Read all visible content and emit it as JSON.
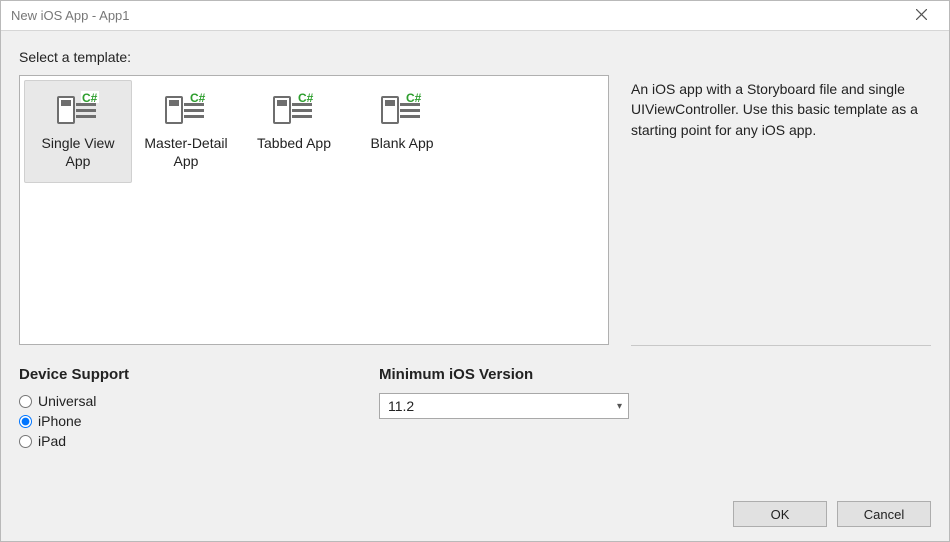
{
  "window": {
    "title": "New iOS App - App1"
  },
  "prompt": "Select a template:",
  "templates": [
    {
      "name": "Single View App",
      "selected": true
    },
    {
      "name": "Master-Detail App",
      "selected": false
    },
    {
      "name": "Tabbed App",
      "selected": false
    },
    {
      "name": "Blank App",
      "selected": false
    }
  ],
  "description": "An iOS app with a Storyboard file and single UIViewController. Use this basic template as a starting point for any iOS app.",
  "device_support": {
    "heading": "Device Support",
    "options": [
      {
        "label": "Universal",
        "checked": false
      },
      {
        "label": "iPhone",
        "checked": true
      },
      {
        "label": "iPad",
        "checked": false
      }
    ]
  },
  "min_ios": {
    "heading": "Minimum iOS Version",
    "selected": "11.2"
  },
  "buttons": {
    "ok": "OK",
    "cancel": "Cancel"
  }
}
